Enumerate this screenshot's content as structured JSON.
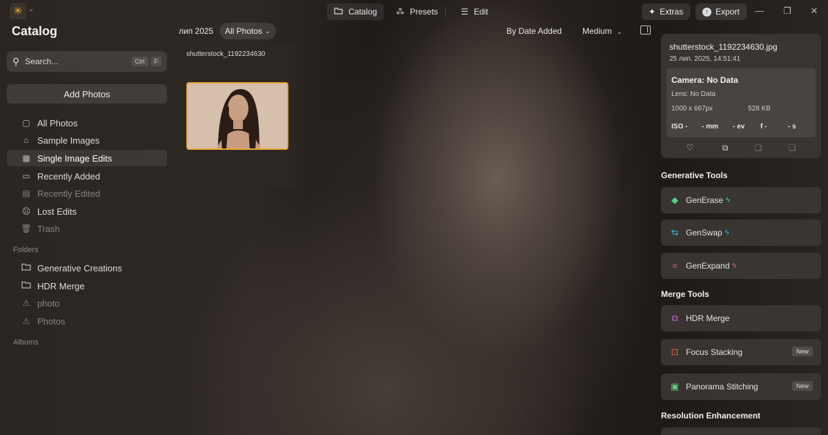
{
  "app": {
    "logo_icon": "sun-icon"
  },
  "topbar": {
    "tabs": [
      {
        "label": "Catalog",
        "icon": "folder-icon"
      },
      {
        "label": "Presets",
        "icon": "magic-wand-icon"
      },
      {
        "label": "Edit",
        "icon": "sliders-icon"
      }
    ],
    "extras_label": "Extras",
    "export_label": "Export"
  },
  "sidebar": {
    "title": "Catalog",
    "search": {
      "placeholder": "Search...",
      "shortcut_ctrl": "Ctrl",
      "shortcut_key": "F"
    },
    "add_photos": "Add Photos",
    "library": [
      {
        "label": "All Photos",
        "icon": "photos-icon"
      },
      {
        "label": "Sample Images",
        "icon": "graduation-cap-icon"
      },
      {
        "label": "Single Image Edits",
        "icon": "grid-icon"
      },
      {
        "label": "Recently Added",
        "icon": "calendar-icon"
      },
      {
        "label": "Recently Edited",
        "icon": "calendar-edit-icon"
      },
      {
        "label": "Lost Edits",
        "icon": "sad-face-icon"
      },
      {
        "label": "Trash",
        "icon": "trash-icon"
      }
    ],
    "folders_label": "Folders",
    "folders": [
      {
        "label": "Generative Creations",
        "icon": "folder-icon"
      },
      {
        "label": "HDR Merge",
        "icon": "folder-icon"
      },
      {
        "label": "photo",
        "icon": "warning-icon"
      },
      {
        "label": "Photos",
        "icon": "warning-icon"
      }
    ],
    "albums_label": "Albums"
  },
  "main": {
    "date_group": "лип 2025",
    "filter": "All Photos",
    "sort": "By Date Added",
    "size": "Medium",
    "photo": {
      "filename": "shutterstock_1192234630"
    }
  },
  "info": {
    "filename": "shutterstock_1192234630.jpg",
    "date": "25 лип. 2025, 14:51:41",
    "camera": "Camera: No Data",
    "lens": "Lens: No Data",
    "dimensions": "1000 x 667px",
    "filesize": "528 KB",
    "exif": {
      "iso": "ISO -",
      "mm": "- mm",
      "ev": "- ev",
      "f": "f -",
      "s": "- s"
    }
  },
  "generative_tools": {
    "heading": "Generative Tools",
    "items": [
      {
        "label": "GenErase",
        "icon": "eraser-icon",
        "color": "#4fd18a"
      },
      {
        "label": "GenSwap",
        "icon": "swap-icon",
        "color": "#3fb6e8"
      },
      {
        "label": "GenExpand",
        "icon": "expand-icon",
        "color": "#e05fb4"
      }
    ]
  },
  "merge_tools": {
    "heading": "Merge Tools",
    "items": [
      {
        "label": "HDR Merge",
        "icon": "hdr-icon",
        "color": "#c668e0",
        "badge": ""
      },
      {
        "label": "Focus Stacking",
        "icon": "focus-icon",
        "color": "#e0645a",
        "badge": "New"
      },
      {
        "label": "Panorama Stitching",
        "icon": "panorama-icon",
        "color": "#5ed17c",
        "badge": "New"
      }
    ]
  },
  "resolution": {
    "heading": "Resolution Enhancement"
  },
  "colors": {
    "accent": "#f0a531"
  }
}
